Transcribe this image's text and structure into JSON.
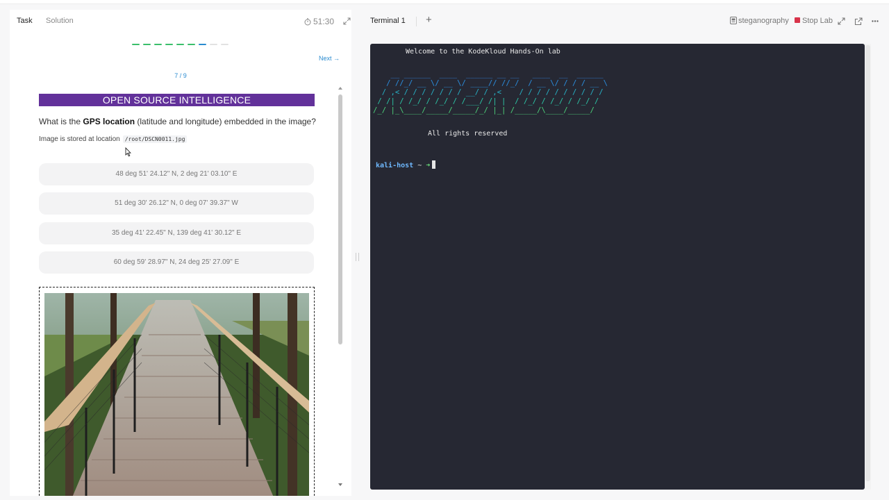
{
  "tabs": {
    "task": "Task",
    "solution": "Solution"
  },
  "timer": "51:30",
  "progress": {
    "current": 7,
    "total": 9
  },
  "nav": {
    "next_label": "Next →",
    "step_text": "7 / 9"
  },
  "question": {
    "banner": "OPEN SOURCE INTELLIGENCE",
    "text_before": "What is the ",
    "text_bold": "GPS location",
    "text_after": " (latitude and longitude) embedded in the image?",
    "location_label": "Image is stored at location",
    "location_path": "/root/DSCN0011.jpg"
  },
  "options": [
    "48 deg 51' 24.12\" N, 2 deg 21' 03.10\" E",
    "51 deg 30' 26.12\" N, 0 deg 07' 39.37\" W",
    "35 deg 41' 22.45\" N, 139 deg 41' 30.12\" E",
    "60 deg 59' 28.97\" N, 24 deg 25' 27.09\" E"
  ],
  "terminal": {
    "tab_label": "Terminal 1",
    "add_tab": "+",
    "lab_name": "steganography",
    "stop_label": "Stop Lab",
    "welcome": "Welcome to the KodeKloud Hands-On lab",
    "rights": "All rights reserved",
    "prompt_host": "kali-host",
    "prompt_tilde": " ~ ",
    "prompt_arrow": "➜"
  },
  "colors": {
    "banner": "#62319a",
    "link": "#2a8bd0",
    "terminal_bg": "#262833",
    "stop": "#d8334a",
    "prompt_host": "#6fb9ff",
    "prompt_arrow": "#6be07c"
  }
}
